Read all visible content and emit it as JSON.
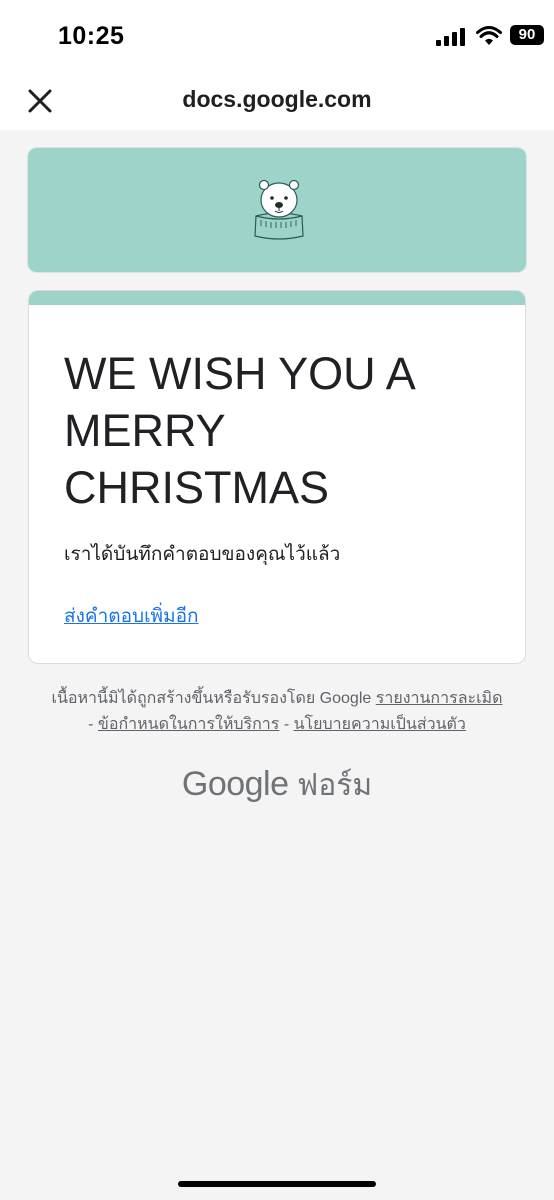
{
  "status_bar": {
    "time": "10:25",
    "battery": "90",
    "icons": [
      "cellular-signal-icon",
      "wifi-icon",
      "battery-icon"
    ]
  },
  "browser": {
    "url": "docs.google.com",
    "close_icon": "close-icon"
  },
  "header": {
    "image": "polar-bear-illustration",
    "color": "#9dd3c9"
  },
  "form": {
    "title": "WE WISH YOU A MERRY CHRISTMAS",
    "confirmation": "เราได้บันทึกคำตอบของคุณไว้แล้ว",
    "resubmit_link": "ส่งคำตอบเพิ่มอีก"
  },
  "footer": {
    "disclaimer": "เนื้อหานี้มิได้ถูกสร้างขึ้นหรือรับรองโดย Google",
    "report_link": "รายงานการละเมิด",
    "separator": "-",
    "terms_link": "ข้อกำหนดในการให้บริการ",
    "privacy_link": "นโยบายความเป็นส่วนตัว"
  },
  "brand": {
    "google": "Google",
    "forms": "ฟอร์ม"
  },
  "colors": {
    "accent": "#9dd3c9",
    "link": "#1a73e8",
    "background": "#f4f4f4"
  }
}
